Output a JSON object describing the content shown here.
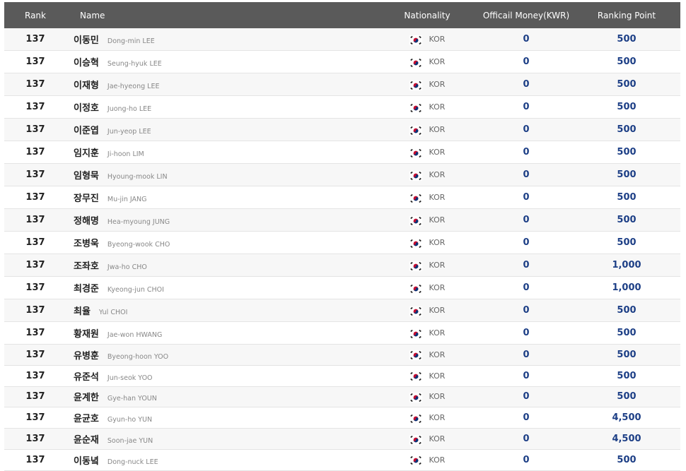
{
  "header": {
    "rank": "Rank",
    "name": "Name",
    "nationality": "Nationality",
    "money": "Officail Money(KWR)",
    "point": "Ranking Point"
  },
  "rows": [
    {
      "rank": "137",
      "name_ko": "이동민",
      "name_en": "Dong-min LEE",
      "nation": "KOR",
      "money": "0",
      "point": "500"
    },
    {
      "rank": "137",
      "name_ko": "이승혁",
      "name_en": "Seung-hyuk LEE",
      "nation": "KOR",
      "money": "0",
      "point": "500"
    },
    {
      "rank": "137",
      "name_ko": "이재형",
      "name_en": "Jae-hyeong LEE",
      "nation": "KOR",
      "money": "0",
      "point": "500"
    },
    {
      "rank": "137",
      "name_ko": "이정호",
      "name_en": "Juong-ho LEE",
      "nation": "KOR",
      "money": "0",
      "point": "500"
    },
    {
      "rank": "137",
      "name_ko": "이준엽",
      "name_en": "Jun-yeop LEE",
      "nation": "KOR",
      "money": "0",
      "point": "500"
    },
    {
      "rank": "137",
      "name_ko": "임지훈",
      "name_en": "Ji-hoon LIM",
      "nation": "KOR",
      "money": "0",
      "point": "500"
    },
    {
      "rank": "137",
      "name_ko": "임형묵",
      "name_en": "Hyoung-mook LIN",
      "nation": "KOR",
      "money": "0",
      "point": "500"
    },
    {
      "rank": "137",
      "name_ko": "장무진",
      "name_en": "Mu-jin JANG",
      "nation": "KOR",
      "money": "0",
      "point": "500"
    },
    {
      "rank": "137",
      "name_ko": "정해명",
      "name_en": "Hea-myoung JUNG",
      "nation": "KOR",
      "money": "0",
      "point": "500"
    },
    {
      "rank": "137",
      "name_ko": "조병욱",
      "name_en": "Byeong-wook CHO",
      "nation": "KOR",
      "money": "0",
      "point": "500"
    },
    {
      "rank": "137",
      "name_ko": "조좌호",
      "name_en": "Jwa-ho CHO",
      "nation": "KOR",
      "money": "0",
      "point": "1,000"
    },
    {
      "rank": "137",
      "name_ko": "최경준",
      "name_en": "Kyeong-jun CHOI",
      "nation": "KOR",
      "money": "0",
      "point": "1,000"
    },
    {
      "rank": "137",
      "name_ko": "최율",
      "name_en": "Yul CHOI",
      "nation": "KOR",
      "money": "0",
      "point": "500"
    },
    {
      "rank": "137",
      "name_ko": "황재원",
      "name_en": "Jae-won HWANG",
      "nation": "KOR",
      "money": "0",
      "point": "500"
    },
    {
      "rank": "137",
      "name_ko": "유병훈",
      "name_en": "Byeong-hoon YOO",
      "nation": "KOR",
      "money": "0",
      "point": "500"
    },
    {
      "rank": "137",
      "name_ko": "유준석",
      "name_en": "Jun-seok YOO",
      "nation": "KOR",
      "money": "0",
      "point": "500"
    },
    {
      "rank": "137",
      "name_ko": "윤계한",
      "name_en": "Gye-han YOUN",
      "nation": "KOR",
      "money": "0",
      "point": "500"
    },
    {
      "rank": "137",
      "name_ko": "윤균호",
      "name_en": "Gyun-ho YUN",
      "nation": "KOR",
      "money": "0",
      "point": "4,500"
    },
    {
      "rank": "137",
      "name_ko": "윤순재",
      "name_en": "Soon-jae YUN",
      "nation": "KOR",
      "money": "0",
      "point": "4,500"
    },
    {
      "rank": "137",
      "name_ko": "이동녘",
      "name_en": "Dong-nuck LEE",
      "nation": "KOR",
      "money": "0",
      "point": "500"
    }
  ],
  "colors": {
    "header_bg": "#5a5a5a",
    "value_blue": "#1d3f86",
    "stripe": "#f7f7f7"
  },
  "icons": {
    "flag": "south-korea-flag-icon"
  }
}
